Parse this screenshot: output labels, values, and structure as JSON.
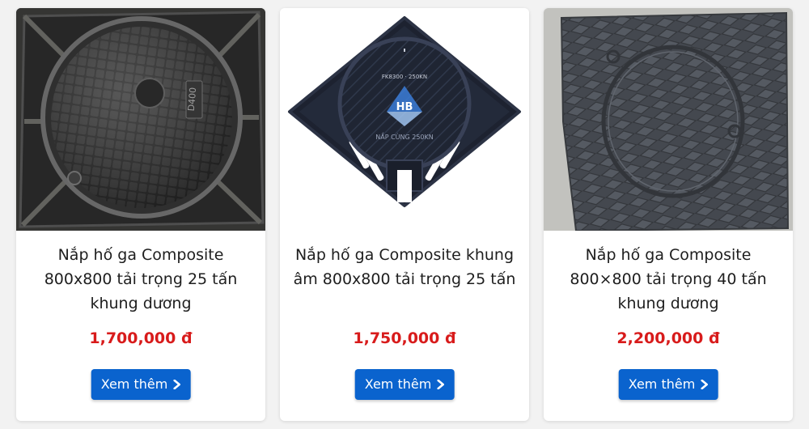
{
  "products": [
    {
      "image_icon": "cast-iron-round-manhole-cover-image",
      "title": "Nắp hố ga Composite 800x800 tải trọng 25 tấn khung dương",
      "price": "1,700,000 đ",
      "button_label": "Xem thêm",
      "image_text": "D400"
    },
    {
      "image_icon": "composite-square-frame-manhole-cover-image",
      "title": "Nắp hố ga Composite khung âm 800x800 tải trọng 25 tấn",
      "price": "1,750,000 đ",
      "button_label": "Xem thêm",
      "image_text": "HB",
      "image_text_2": "NẮP CÙNG 250KN"
    },
    {
      "image_icon": "composite-diamond-plate-manhole-cover-image",
      "title": "Nắp hố ga Composite 800×800 tải trọng 40 tấn khung dương",
      "price": "2,200,000 đ",
      "button_label": "Xem thêm"
    }
  ],
  "colors": {
    "price": "#d81b1b",
    "button": "#0a63ce",
    "background": "#f2f2f2"
  },
  "icons": {
    "button_icon": "chevron-right-icon"
  }
}
